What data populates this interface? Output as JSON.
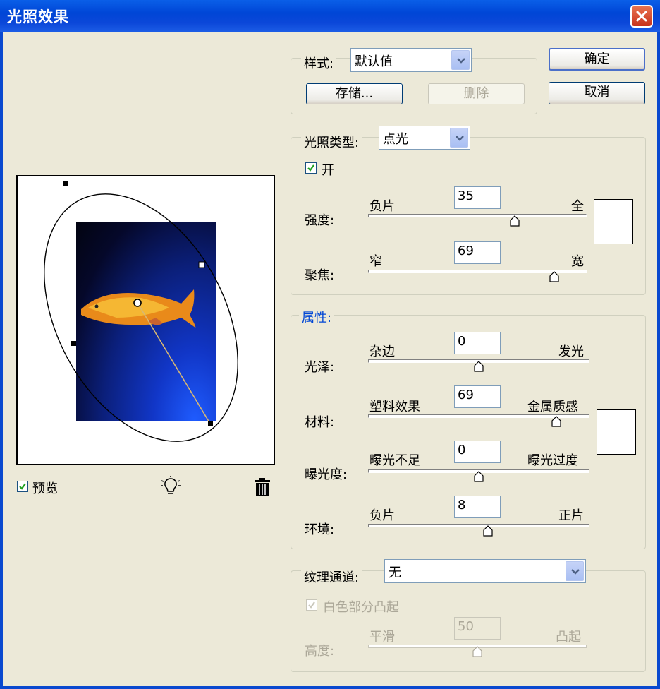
{
  "window": {
    "title": "光照效果"
  },
  "preview": {
    "label": "预览",
    "checked": true
  },
  "style": {
    "label": "样式:",
    "value": "默认值",
    "save_label": "存储...",
    "delete_label": "删除"
  },
  "actions": {
    "ok_label": "确定",
    "cancel_label": "取消"
  },
  "light": {
    "type_label": "光照类型:",
    "type_value": "点光",
    "on_label": "开",
    "on_checked": true,
    "intensity": {
      "label": "强度:",
      "min_label": "负片",
      "max_label": "全",
      "value": "35",
      "fraction": 0.67
    },
    "focus": {
      "label": "聚焦:",
      "min_label": "窄",
      "max_label": "宽",
      "value": "69",
      "fraction": 0.85
    }
  },
  "properties": {
    "legend": "属性:",
    "gloss": {
      "label": "光泽:",
      "min_label": "杂边",
      "max_label": "发光",
      "value": "0",
      "fraction": 0.5
    },
    "material": {
      "label": "材料:",
      "min_label": "塑料效果",
      "max_label": "金属质感",
      "value": "69",
      "fraction": 0.85
    },
    "exposure": {
      "label": "曝光度:",
      "min_label": "曝光不足",
      "max_label": "曝光过度",
      "value": "0",
      "fraction": 0.5
    },
    "ambience": {
      "label": "环境:",
      "min_label": "负片",
      "max_label": "正片",
      "value": "8",
      "fraction": 0.54
    }
  },
  "texture": {
    "channel_label": "纹理通道:",
    "channel_value": "无",
    "white_high_label": "白色部分凸起",
    "white_high_checked": true,
    "height": {
      "label": "高度:",
      "min_label": "平滑",
      "max_label": "凸起",
      "value": "50",
      "fraction": 0.5
    }
  },
  "colors": {
    "titlebar": "#0a5fe8",
    "dialog_bg": "#ece9d8",
    "legend_blue": "#0046d5",
    "light_swatch": "#ffffff",
    "ambience_swatch": "#ffffff"
  }
}
